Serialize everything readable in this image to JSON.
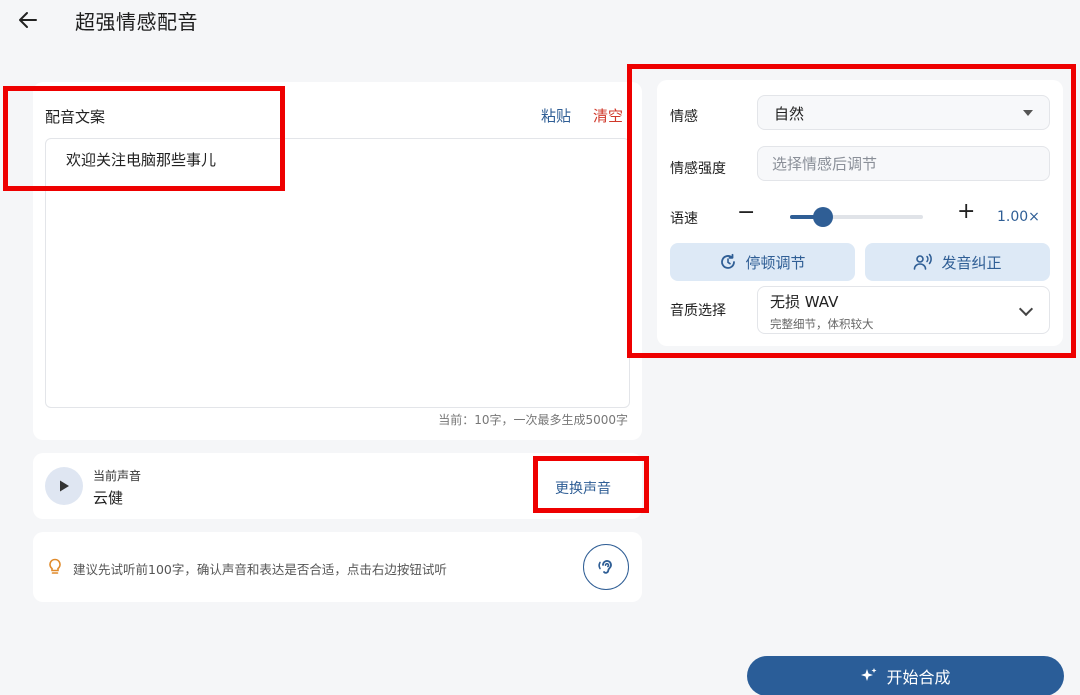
{
  "header": {
    "back_icon": "arrow-left-icon",
    "title": "超强情感配音"
  },
  "script": {
    "label": "配音文案",
    "paste": "粘贴",
    "clear": "清空",
    "text": "欢迎关注电脑那些事儿",
    "count": "当前：10字，一次最多生成5000字"
  },
  "voice": {
    "play_icon": "play-icon",
    "caption": "当前声音",
    "name": "云健",
    "change": "更换声音"
  },
  "tip": {
    "icon": "lightbulb-icon",
    "text": "建议先试听前100字，确认声音和表达是否合适，点击右边按钮试听",
    "listen_icon": "ear-icon"
  },
  "settings": {
    "emotion_label": "情感",
    "emotion_value": "自然",
    "intensity_label": "情感强度",
    "intensity_placeholder": "选择情感后调节",
    "speed_label": "语速",
    "speed_minus": "−",
    "speed_plus": "+",
    "speed_value": "1.00×",
    "speed_level": 0.25,
    "pause_label": "停顿调节",
    "pause_icon": "timer-refresh-icon",
    "pron_label": "发音纠正",
    "pron_icon": "speaking-person-icon",
    "quality_label": "音质选择",
    "quality_title": "无损 WAV",
    "quality_sub": "完整细节，体积较大"
  },
  "actions": {
    "start": "开始合成",
    "start_icon": "sparkle-icon"
  },
  "colors": {
    "accent": "#2f5e95",
    "danger": "#d0392b",
    "highlight": "#ee0000"
  }
}
